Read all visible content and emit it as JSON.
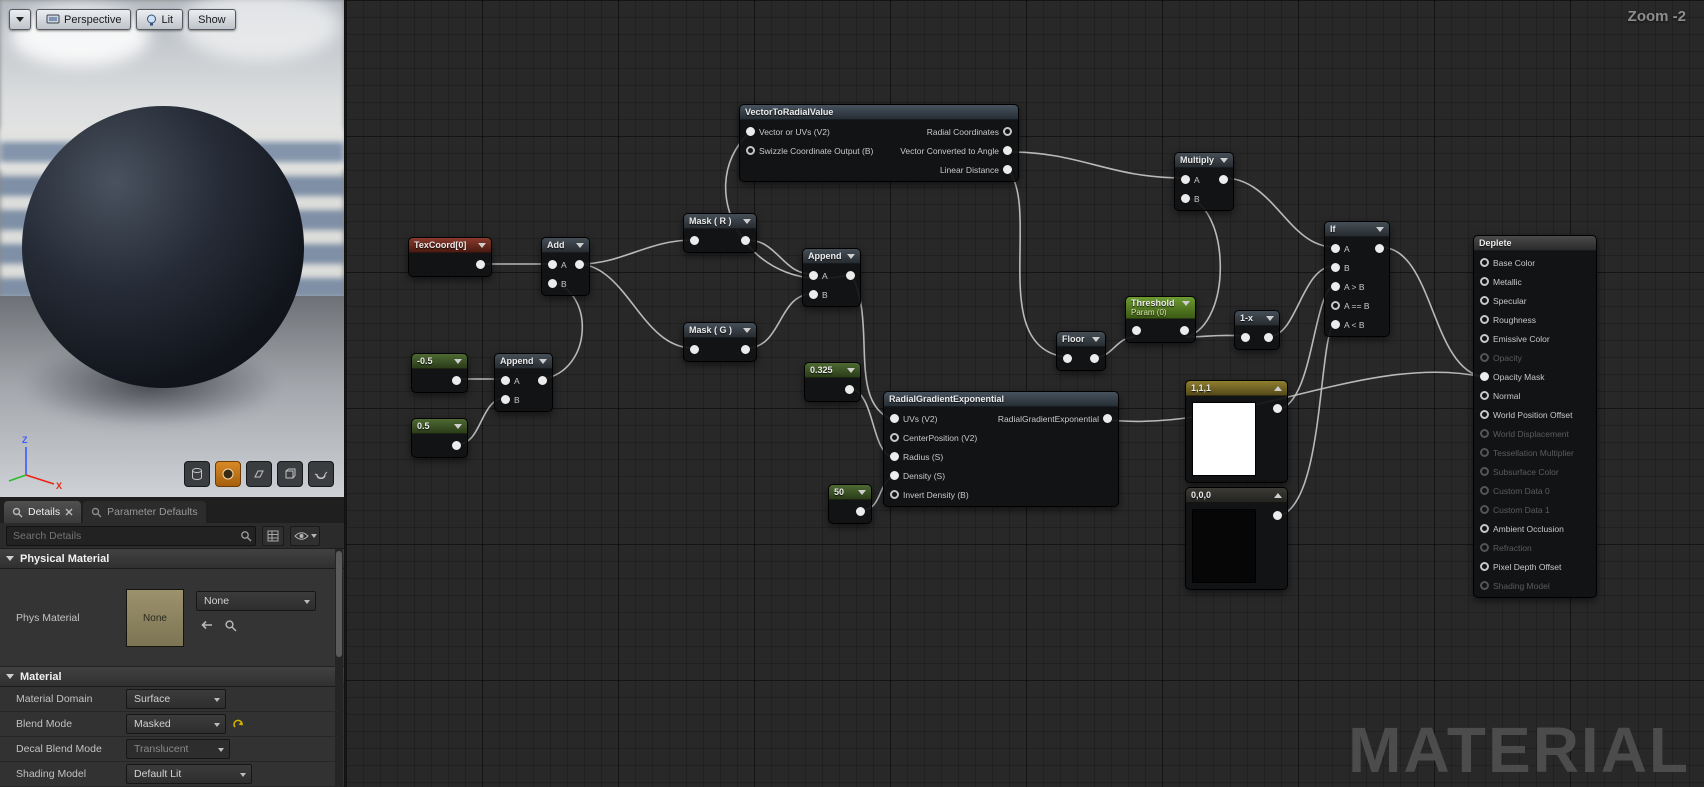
{
  "left_panel": {
    "viewport_toolbar": {
      "perspective": "Perspective",
      "lit": "Lit",
      "show": "Show"
    },
    "tabs": {
      "details": "Details",
      "parameter_defaults": "Parameter Defaults"
    },
    "search": {
      "placeholder": "Search Details"
    },
    "physical_material": {
      "title": "Physical Material",
      "row_label": "Phys Material",
      "thumbnail_text": "None",
      "value": "None"
    },
    "material": {
      "title": "Material",
      "rows": [
        {
          "label": "Material Domain",
          "value": "Surface"
        },
        {
          "label": "Blend Mode",
          "value": "Masked"
        },
        {
          "label": "Decal Blend Mode",
          "value": "Translucent"
        },
        {
          "label": "Shading Model",
          "value": "Default Lit"
        }
      ]
    }
  },
  "graph": {
    "zoom_label": "Zoom -2",
    "watermark": "MATERIAL",
    "nodes": {
      "vector_to_radial": {
        "title": "VectorToRadialValue",
        "inputs": [
          "Vector or UVs (V2)",
          "Swizzle Coordinate Output (B)"
        ],
        "outputs": [
          "Radial Coordinates",
          "Vector Converted to Angle",
          "Linear Distance"
        ]
      },
      "multiply": {
        "title": "Multiply",
        "inputs": [
          "A",
          "B"
        ]
      },
      "if": {
        "title": "If",
        "inputs": [
          "A",
          "B",
          "A > B",
          "A == B",
          "A < B"
        ]
      },
      "output": {
        "title": "Deplete",
        "pins": [
          "Base Color",
          "Metallic",
          "Specular",
          "Roughness",
          "Emissive Color",
          "Opacity",
          "Opacity Mask",
          "Normal",
          "World Position Offset",
          "World Displacement",
          "Tessellation Multiplier",
          "Subsurface Color",
          "Custom Data 0",
          "Custom Data 1",
          "Ambient Occlusion",
          "Refraction",
          "Pixel Depth Offset",
          "Shading Model"
        ]
      },
      "texcoord": {
        "title": "TexCoord[0]"
      },
      "add": {
        "title": "Add",
        "inputs": [
          "A",
          "B"
        ]
      },
      "mask_r": {
        "title": "Mask ( R )"
      },
      "mask_g": {
        "title": "Mask ( G )"
      },
      "append1": {
        "title": "Append",
        "inputs": [
          "A",
          "B"
        ]
      },
      "append2": {
        "title": "Append",
        "inputs": [
          "A",
          "B"
        ]
      },
      "const_neg05": {
        "title": "-0.5"
      },
      "const_05": {
        "title": "0.5"
      },
      "const_0325": {
        "title": "0.325"
      },
      "const_50": {
        "title": "50"
      },
      "radial_gradient": {
        "title": "RadialGradientExponential",
        "inputs": [
          "UVs (V2)",
          "CenterPosition (V2)",
          "Radius (S)",
          "Density (S)",
          "Invert Density (B)"
        ],
        "output": "RadialGradientExponential"
      },
      "threshold": {
        "title": "Threshold",
        "subtitle": "Param (0)"
      },
      "one_minus_x": {
        "title": "1-x"
      },
      "floor": {
        "title": "Floor"
      },
      "vec_white": {
        "title": "1,1,1"
      },
      "vec_black": {
        "title": "0,0,0"
      }
    }
  }
}
